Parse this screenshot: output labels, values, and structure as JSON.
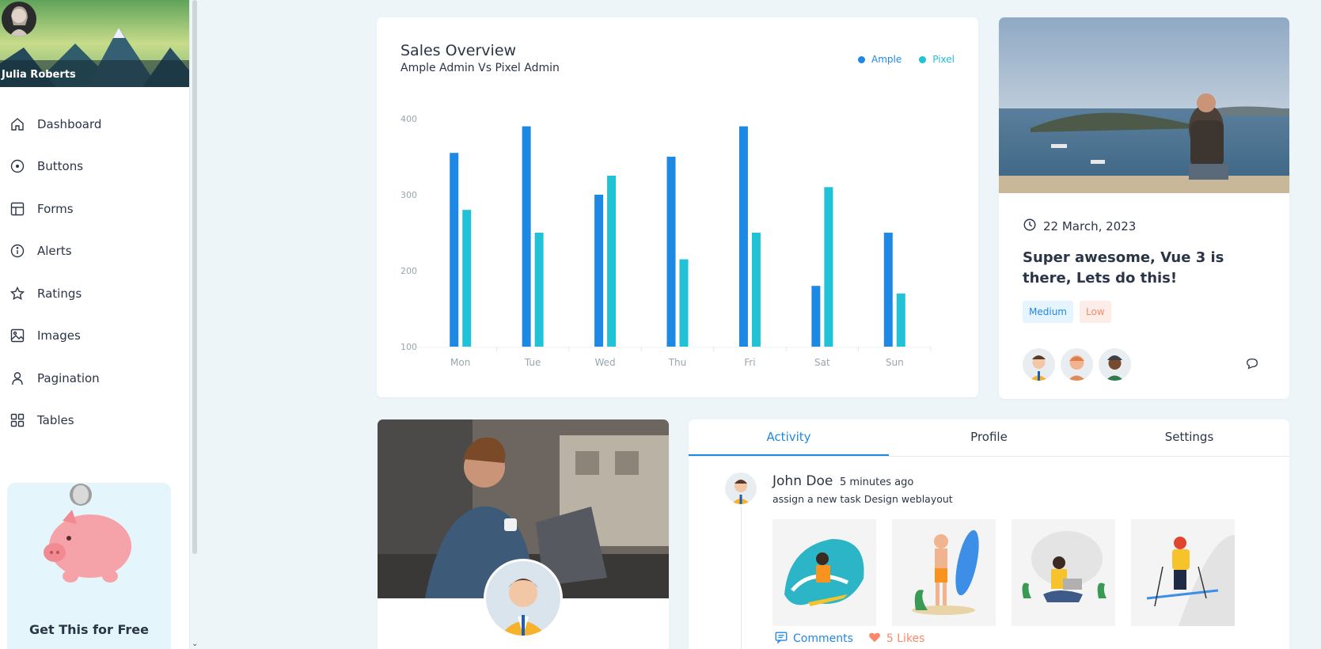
{
  "sidebar": {
    "user_name": "Julia Roberts",
    "items": [
      {
        "label": "Dashboard",
        "icon": "home-icon"
      },
      {
        "label": "Buttons",
        "icon": "circle-dot-icon"
      },
      {
        "label": "Forms",
        "icon": "table-layout-icon"
      },
      {
        "label": "Alerts",
        "icon": "info-circle-icon"
      },
      {
        "label": "Ratings",
        "icon": "star-icon"
      },
      {
        "label": "Images",
        "icon": "image-icon"
      },
      {
        "label": "Pagination",
        "icon": "user-icon"
      },
      {
        "label": "Tables",
        "icon": "grid-icon"
      }
    ],
    "promo_title": "Get This for Free"
  },
  "sales": {
    "title": "Sales Overview",
    "subtitle": "Ample Admin Vs Pixel Admin"
  },
  "chart_data": {
    "type": "bar",
    "categories": [
      "Mon",
      "Tue",
      "Wed",
      "Thu",
      "Fri",
      "Sat",
      "Sun"
    ],
    "series": [
      {
        "name": "Ample",
        "color": "#1e88e5",
        "values": [
          355,
          390,
          300,
          350,
          390,
          180,
          250
        ]
      },
      {
        "name": "Pixel",
        "color": "#21c1d6",
        "values": [
          280,
          250,
          325,
          215,
          250,
          310,
          170
        ]
      }
    ],
    "y_ticks": [
      "100",
      "200",
      "300",
      "400"
    ],
    "ylim": [
      100,
      400
    ],
    "grid": false,
    "legend_position": "top-right"
  },
  "blog": {
    "date": "22 March, 2023",
    "headline": "Super awesome, Vue 3 is there, Lets do this!",
    "tags": [
      "Medium",
      "Low"
    ]
  },
  "activity": {
    "tabs": [
      "Activity",
      "Profile",
      "Settings"
    ],
    "active_tab": "Activity",
    "entry": {
      "name": "John Doe",
      "time": "5 minutes ago",
      "description": "assign a new task Design weblayout",
      "comments_label": "Comments",
      "likes_label": "5 Likes"
    }
  },
  "colors": {
    "primary": "#1e88e5",
    "secondary": "#21c1d6",
    "danger": "#fa896b",
    "background": "#eef5f9"
  }
}
